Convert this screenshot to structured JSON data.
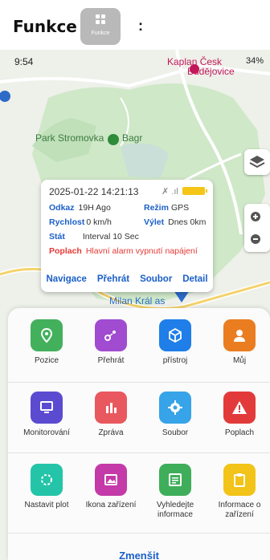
{
  "header": {
    "title": "Funkce",
    "app_icon_label": "Funkce",
    "colon": ":"
  },
  "status_bar": {
    "time": "9:54",
    "battery": "34%"
  },
  "map": {
    "places": {
      "budejovice_top": "Kaplan Česk",
      "budejovice_bottom": "Budějovice",
      "park": "Park Stromovka",
      "bagr": "Bagr",
      "milan": "Milan Král as"
    }
  },
  "info_card": {
    "datetime": "2025-01-22 14:21:13",
    "odkaz_label": "Odkaz",
    "odkaz_value": "19H Ago",
    "rezim_label": "Režim",
    "rezim_value": "GPS",
    "rychlost_label": "Rychlost",
    "rychlost_value": "0 km/h",
    "vylet_label": "Výlet",
    "vylet_value": "Dnes 0km",
    "stat_label": "Stát",
    "stat_value": "Interval 10 Sec",
    "poplach_label": "Poplach",
    "poplach_value": "Hlavní alarm vypnutí napájení",
    "links": {
      "navigace": "Navigace",
      "prehrat": "Přehrát",
      "soubor": "Soubor",
      "detail": "Detail"
    }
  },
  "panel": {
    "tiles": [
      {
        "label": "Pozice",
        "color": "#43b05c",
        "icon": "location-pin-icon"
      },
      {
        "label": "Přehrát",
        "color": "#a14bd0",
        "icon": "route-icon"
      },
      {
        "label": "přístroj",
        "color": "#1f7ee8",
        "icon": "cube-icon"
      },
      {
        "label": "Můj",
        "color": "#ea7d20",
        "icon": "person-icon"
      },
      {
        "label": "Monitorování",
        "color": "#5b4bd0",
        "icon": "monitor-icon"
      },
      {
        "label": "Zpráva",
        "color": "#e8585e",
        "icon": "bar-chart-icon"
      },
      {
        "label": "Soubor",
        "color": "#37a3e8",
        "icon": "gear-icon"
      },
      {
        "label": "Poplach",
        "color": "#e23a3a",
        "icon": "warning-icon"
      },
      {
        "label": "Nastavit plot",
        "color": "#24c4a8",
        "icon": "fence-icon"
      },
      {
        "label": "Ikona zařízení",
        "color": "#c43aa8",
        "icon": "image-icon"
      },
      {
        "label": "Vyhledejte informace",
        "color": "#3fae5a",
        "icon": "search-info-icon"
      },
      {
        "label": "Informace o zařízení",
        "color": "#f2c318",
        "icon": "clipboard-icon"
      }
    ],
    "shrink_label": "Zmenšit"
  }
}
